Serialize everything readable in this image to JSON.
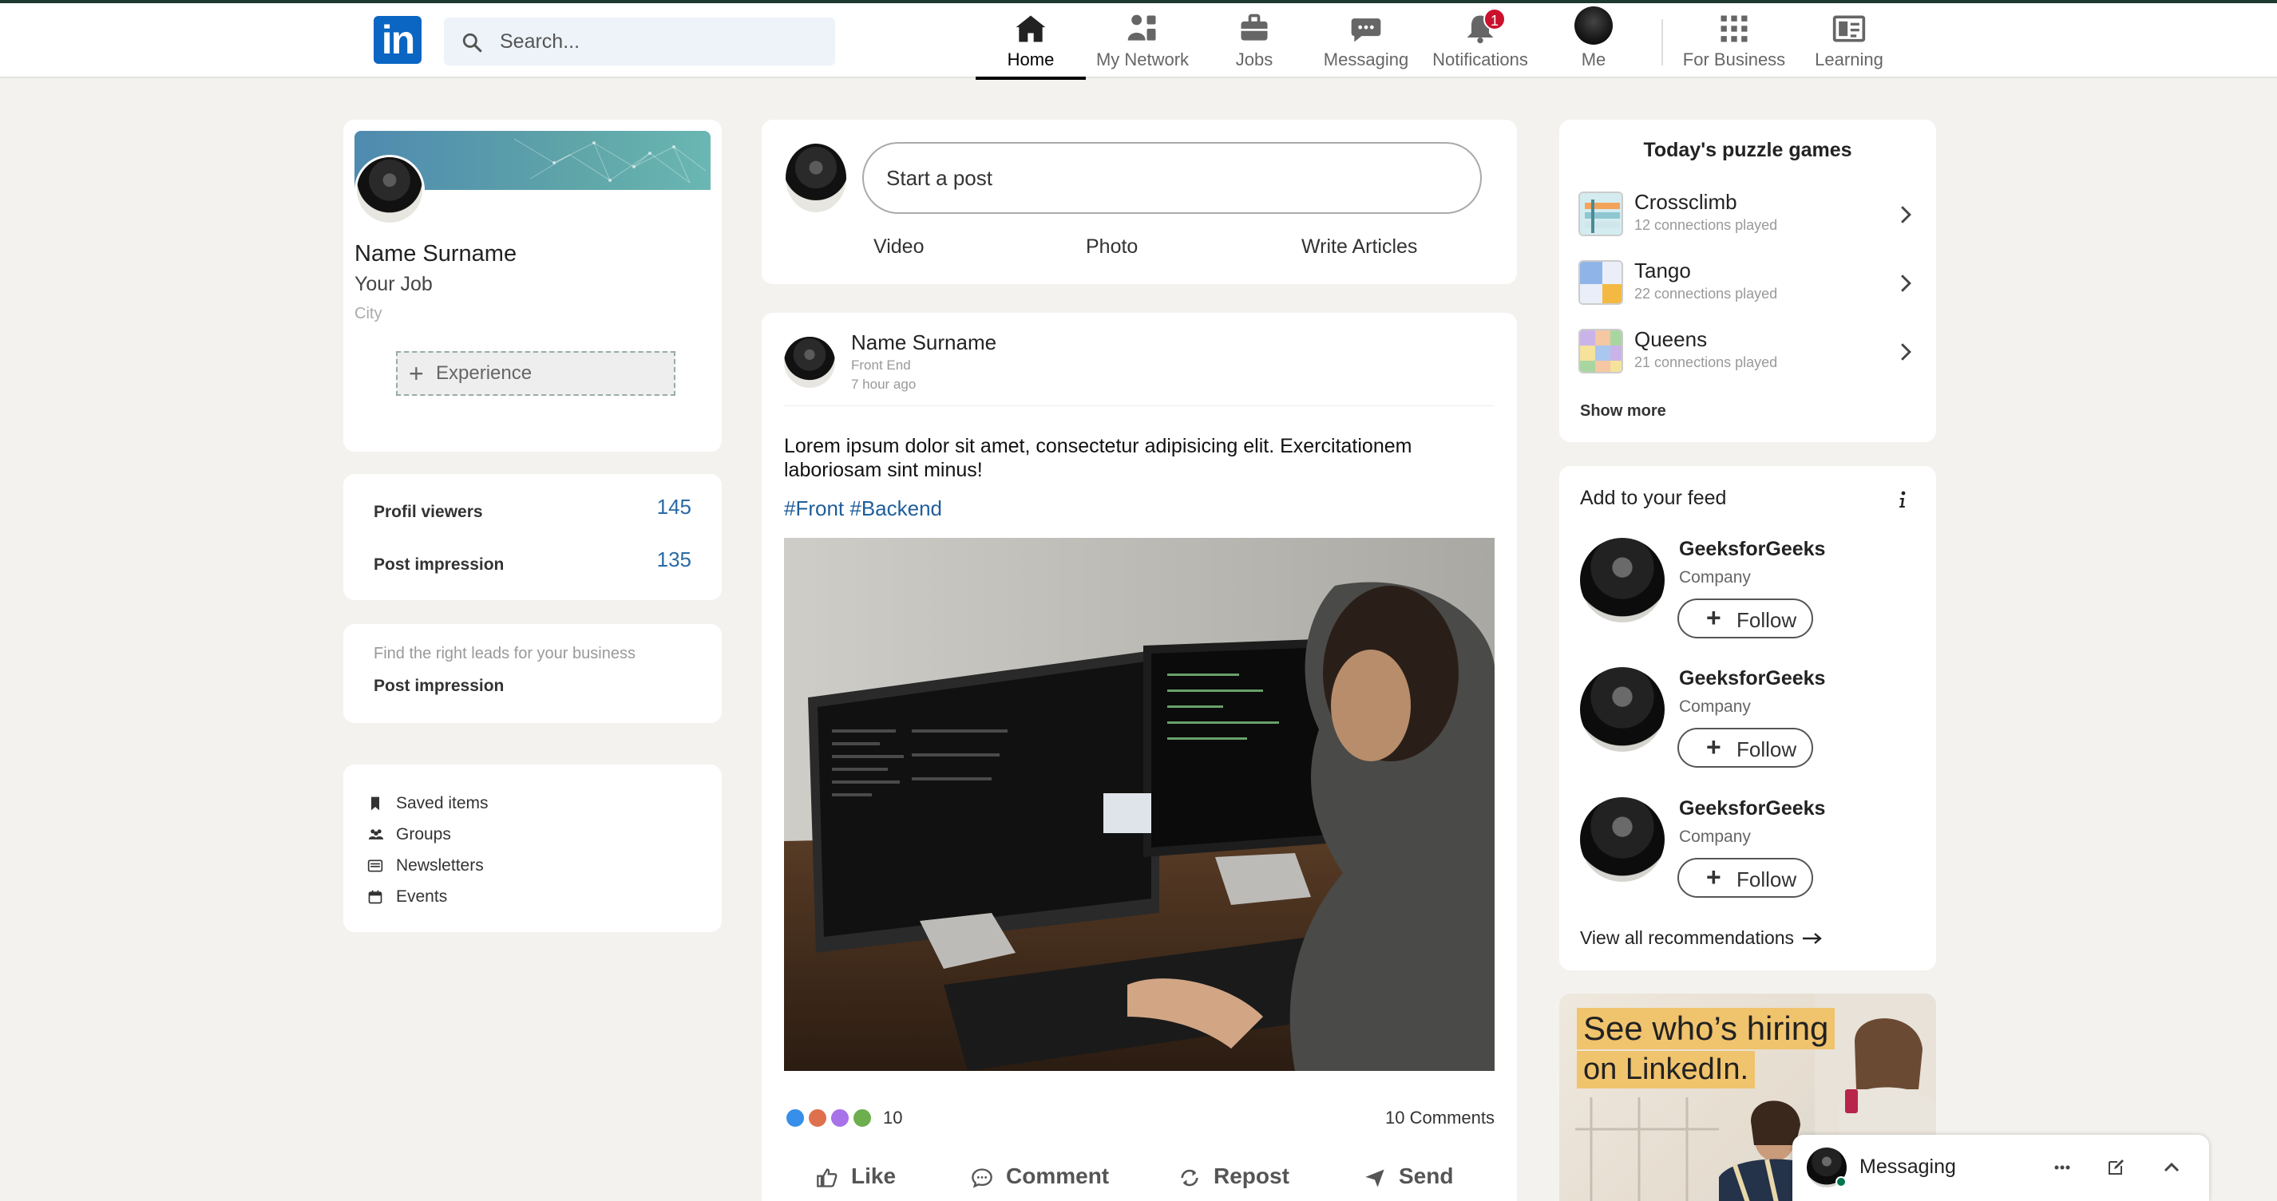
{
  "navbar": {
    "logo_text": "in",
    "search_placeholder": "Search...",
    "items": [
      {
        "label": "Home",
        "icon": "home-icon",
        "active": true
      },
      {
        "label": "My Network",
        "icon": "network-icon"
      },
      {
        "label": "Jobs",
        "icon": "briefcase-icon"
      },
      {
        "label": "Messaging",
        "icon": "chat-icon"
      },
      {
        "label": "Notifications",
        "icon": "bell-icon",
        "badge": "1"
      },
      {
        "label": "Me",
        "icon": "avatar"
      },
      {
        "label": "For Business",
        "icon": "grid-icon"
      },
      {
        "label": "Learning",
        "icon": "learning-icon"
      }
    ]
  },
  "profile": {
    "name": "Name Surname",
    "job": "Your Job",
    "city": "City",
    "experience_button": "Experience"
  },
  "stats": [
    {
      "label": "Profil viewers",
      "value": "145"
    },
    {
      "label": "Post impression",
      "value": "135"
    }
  ],
  "promo": {
    "text": "Find the right leads for your business",
    "label": "Post impression"
  },
  "shortcuts": [
    {
      "label": "Saved items",
      "icon": "bookmark-icon"
    },
    {
      "label": "Groups",
      "icon": "groups-icon"
    },
    {
      "label": "Newsletters",
      "icon": "newsletter-icon"
    },
    {
      "label": "Events",
      "icon": "calendar-icon"
    }
  ],
  "composer": {
    "placeholder": "Start a post",
    "actions": [
      "Video",
      "Photo",
      "Write Articles"
    ]
  },
  "post": {
    "author": "Name Surname",
    "role": "Front End",
    "time": "7 hour ago",
    "body": "Lorem ipsum dolor sit amet, consectetur adipisicing elit. Exercitationem laboriosam sint minus!",
    "hashtags": "#Front #Backend",
    "reaction_count": "10",
    "comments": "10 Comments",
    "buttons": [
      "Like",
      "Comment",
      "Repost",
      "Send"
    ]
  },
  "puzzles": {
    "title": "Today's puzzle games",
    "games": [
      {
        "name": "Crossclimb",
        "sub": "12 connections played"
      },
      {
        "name": "Tango",
        "sub": "22 connections played"
      },
      {
        "name": "Queens",
        "sub": "21 connections played"
      }
    ],
    "show_more": "Show more"
  },
  "feed": {
    "title": "Add to your feed",
    "recommendations": [
      {
        "name": "GeeksforGeeks",
        "type": "Company",
        "button": "Follow"
      },
      {
        "name": "GeeksforGeeks",
        "type": "Company",
        "button": "Follow"
      },
      {
        "name": "GeeksforGeeks",
        "type": "Company",
        "button": "Follow"
      }
    ],
    "view_all": "View all recommendations"
  },
  "ad": {
    "line1": "See who’s hiring",
    "line2": "on LinkedIn."
  },
  "messaging": {
    "label": "Messaging"
  },
  "colors": {
    "brand": "#0a66c2",
    "background": "#f4f2ee",
    "badge": "#cb112d",
    "hashtag": "#1f5e9b",
    "stat_value": "#2a6aa6"
  }
}
